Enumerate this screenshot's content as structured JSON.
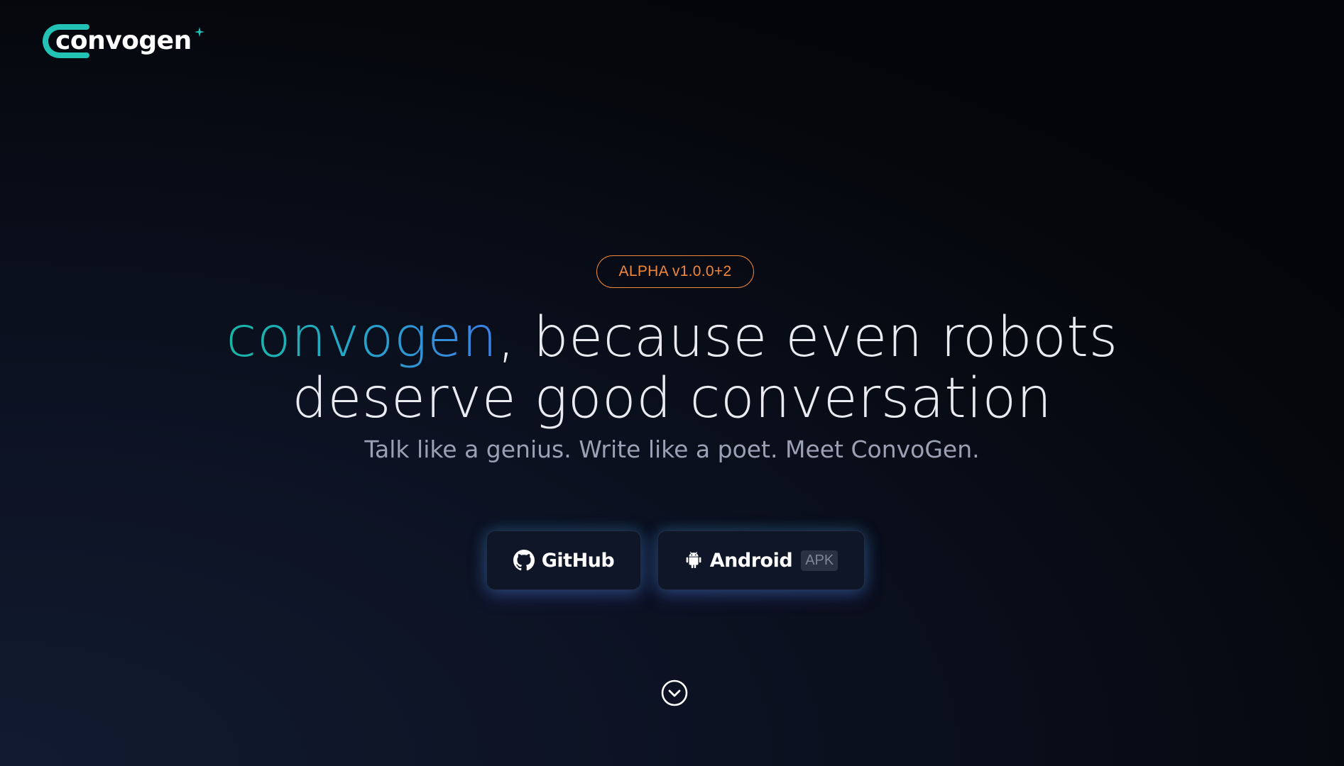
{
  "logo": {
    "text": "convogen",
    "accent_color": "#22c3b4"
  },
  "badge": {
    "label": "ALPHA v1.0.0+2",
    "color": "#f0873a"
  },
  "headline": {
    "brand": "convogen",
    "rest_line1": ", because even robots",
    "line2": "deserve good conversation"
  },
  "subheadline": "Talk like a genius. Write like a poet. Meet ConvoGen.",
  "buttons": {
    "github": {
      "label": "GitHub",
      "icon": "github-icon"
    },
    "android": {
      "label": "Android",
      "tag": "APK",
      "icon": "android-icon"
    }
  },
  "scroll_indicator": {
    "icon": "chevron-down-circle-icon"
  }
}
